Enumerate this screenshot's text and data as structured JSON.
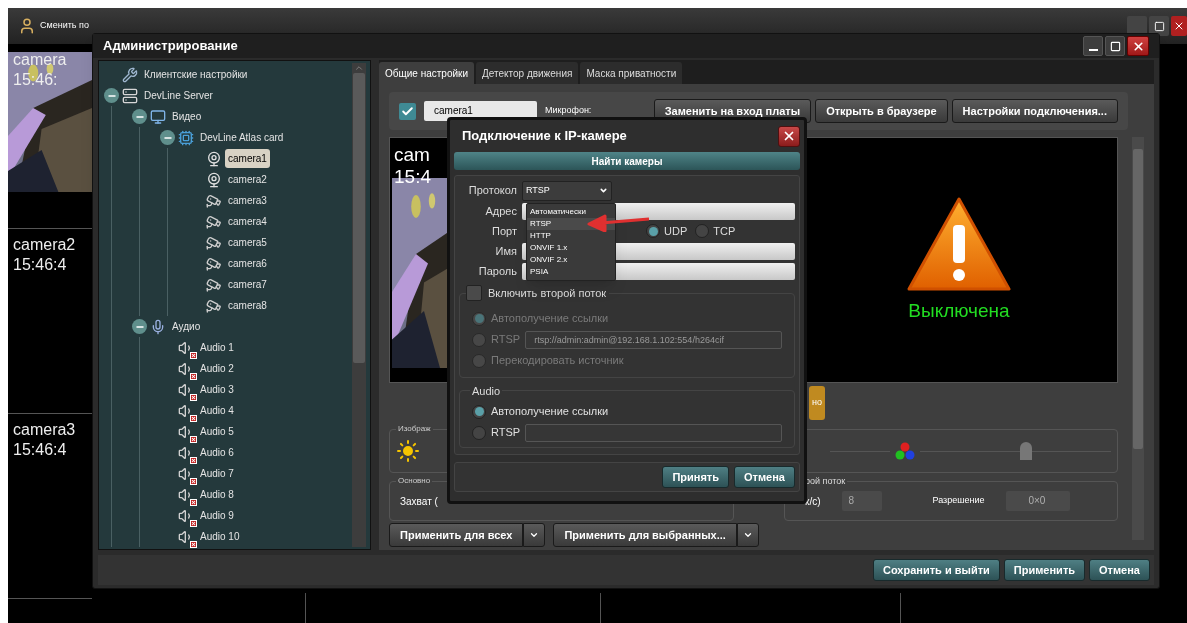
{
  "background": {
    "toolbar_label": "Сменить по",
    "panes": [
      {
        "name": "camera",
        "time": "15:46:",
        "kind": "picture"
      },
      {
        "name": "camera2",
        "time": "15:46:4",
        "kind": "empty"
      },
      {
        "name": "camera3",
        "time": "15:46:4",
        "kind": "empty"
      }
    ]
  },
  "admin": {
    "title": "Администрирование",
    "tree": [
      {
        "label": "Клиентские настройки",
        "kind": "tools",
        "selected": false
      },
      {
        "label": "DevLine Server",
        "kind": "server",
        "selected": false,
        "expanded": true,
        "children": [
          {
            "label": "Видео",
            "kind": "monitor",
            "selected": false,
            "expanded": true,
            "children": [
              {
                "label": "DevLine Atlas card",
                "kind": "card",
                "selected": false,
                "expanded": true,
                "children": [
                  {
                    "label": "camera1",
                    "kind": "webcam",
                    "selected": true
                  },
                  {
                    "label": "camera2",
                    "kind": "webcam",
                    "selected": false
                  },
                  {
                    "label": "camera3",
                    "kind": "cctv",
                    "selected": false
                  },
                  {
                    "label": "camera4",
                    "kind": "cctv",
                    "selected": false
                  },
                  {
                    "label": "camera5",
                    "kind": "cctv",
                    "selected": false
                  },
                  {
                    "label": "camera6",
                    "kind": "cctv",
                    "selected": false
                  },
                  {
                    "label": "camera7",
                    "kind": "cctv",
                    "selected": false
                  },
                  {
                    "label": "camera8",
                    "kind": "cctv",
                    "selected": false
                  }
                ]
              }
            ]
          },
          {
            "label": "Аудио",
            "kind": "mic",
            "selected": false,
            "expanded": true,
            "children": [
              {
                "label": "Audio 1",
                "kind": "speaker",
                "selected": false
              },
              {
                "label": "Audio 2",
                "kind": "speaker",
                "selected": false
              },
              {
                "label": "Audio 3",
                "kind": "speaker",
                "selected": false
              },
              {
                "label": "Audio 4",
                "kind": "speaker",
                "selected": false
              },
              {
                "label": "Audio 5",
                "kind": "speaker",
                "selected": false
              },
              {
                "label": "Audio 6",
                "kind": "speaker",
                "selected": false
              },
              {
                "label": "Audio 7",
                "kind": "speaker",
                "selected": false
              },
              {
                "label": "Audio 8",
                "kind": "speaker",
                "selected": false
              },
              {
                "label": "Audio 9",
                "kind": "speaker",
                "selected": false
              },
              {
                "label": "Audio 10",
                "kind": "speaker",
                "selected": false
              }
            ]
          }
        ]
      }
    ],
    "tabs": [
      {
        "label": "Общие настройки",
        "selected": true
      },
      {
        "label": "Детектор движения",
        "selected": false
      },
      {
        "label": "Маска приватности",
        "selected": false
      }
    ],
    "camera": {
      "enabled": true,
      "name": "camera1",
      "mic_label": "Микрофон:"
    },
    "top_buttons": [
      "Заменить на вход платы",
      "Открыть в браузере",
      "Настройки подключения..."
    ],
    "preview": {
      "overlay_name": "cam",
      "overlay_time": "15:4"
    },
    "status": "Выключена",
    "yellow_button": "но",
    "image_group": "Изображ",
    "basic_group": {
      "title": "Основно",
      "capture": "Захват ("
    },
    "second_stream": {
      "title": "рой поток",
      "fps_label": "к/с)",
      "fps": "8",
      "res_label": "Разрешение",
      "res": "0×0"
    },
    "apply_buttons": [
      "Применить для всех",
      "Применить для выбранных..."
    ],
    "footer_buttons": [
      "Сохранить и выйти",
      "Применить",
      "Отмена"
    ]
  },
  "dialog": {
    "title": "Подключение к IP-камере",
    "find_button": "Найти камеры",
    "protocol_label": "Протокол",
    "protocol": "RTSP",
    "protocol_options": [
      {
        "label": "Автоматически",
        "selected": false
      },
      {
        "label": "RTSP",
        "selected": true
      },
      {
        "label": "HTTP",
        "selected": false
      },
      {
        "label": "ONVIF 1.x",
        "selected": false
      },
      {
        "label": "ONVIF 2.x",
        "selected": false
      },
      {
        "label": "PSIA",
        "selected": false
      }
    ],
    "address_label": "Адрес",
    "port_label": "Порт",
    "transport": [
      {
        "label": "UDP",
        "selected": true
      },
      {
        "label": "TCP",
        "selected": false
      }
    ],
    "name_label": "Имя",
    "password_label": "Пароль",
    "second_stream": {
      "label": "Включить второй поток",
      "enabled": false,
      "disabled": true,
      "options": [
        {
          "kind": "radio",
          "label": "Автополучение ссылки",
          "selected": true
        },
        {
          "kind": "radio_field",
          "label": "RTSP",
          "value": "rtsp://admin:admin@192.168.1.102:554/h264cif",
          "selected": false
        },
        {
          "kind": "radio",
          "label": "Перекодировать источник",
          "selected": false
        }
      ]
    },
    "audio": {
      "title": "Audio",
      "options": [
        {
          "kind": "radio",
          "label": "Автополучение ссылки",
          "selected": true
        },
        {
          "kind": "radio_field",
          "label": "RTSP",
          "selected": false
        }
      ]
    },
    "buttons": [
      "Принять",
      "Отмена"
    ]
  }
}
